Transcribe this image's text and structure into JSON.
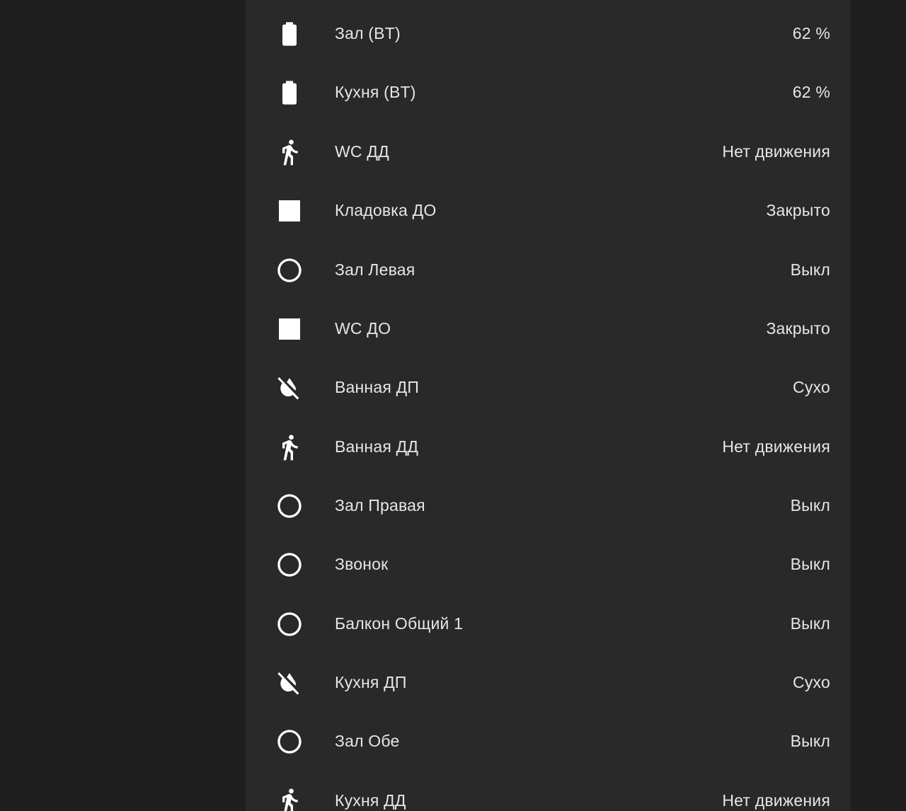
{
  "entities": [
    {
      "icon": "battery-icon",
      "name": "Зал (BT)",
      "state": "62 %"
    },
    {
      "icon": "battery-icon",
      "name": "Кухня (BT)",
      "state": "62 %"
    },
    {
      "icon": "walk-icon",
      "name": "WC ДД",
      "state": "Нет движения"
    },
    {
      "icon": "square-icon",
      "name": "Кладовка ДО",
      "state": "Закрыто"
    },
    {
      "icon": "circle-outline-icon",
      "name": "Зал Левая",
      "state": "Выкл"
    },
    {
      "icon": "square-icon",
      "name": "WC ДО",
      "state": "Закрыто"
    },
    {
      "icon": "water-off-icon",
      "name": "Ванная ДП",
      "state": "Сухо"
    },
    {
      "icon": "walk-icon",
      "name": "Ванная ДД",
      "state": "Нет движения"
    },
    {
      "icon": "circle-outline-icon",
      "name": "Зал Правая",
      "state": "Выкл"
    },
    {
      "icon": "circle-outline-icon",
      "name": "Звонок",
      "state": "Выкл"
    },
    {
      "icon": "circle-outline-icon",
      "name": "Балкон Общий 1",
      "state": "Выкл"
    },
    {
      "icon": "water-off-icon",
      "name": "Кухня ДП",
      "state": "Сухо"
    },
    {
      "icon": "circle-outline-icon",
      "name": "Зал Обе",
      "state": "Выкл"
    },
    {
      "icon": "walk-icon",
      "name": "Кухня ДД",
      "state": "Нет движения"
    }
  ],
  "colors": {
    "background": "#1f1f1f",
    "card": "#292929",
    "text": "#e6e6e6",
    "icon": "#ffffff"
  }
}
